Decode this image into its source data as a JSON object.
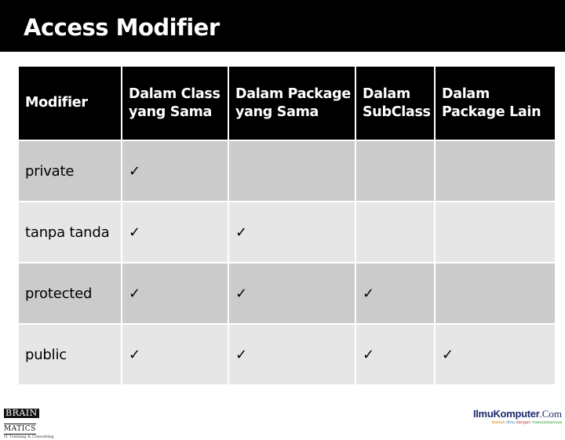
{
  "slide": {
    "title": "Access Modifier"
  },
  "table": {
    "headers": [
      "Modifier",
      "Dalam Class yang Sama",
      "Dalam Package yang Sama",
      "Dalam SubClass",
      "Dalam Package Lain"
    ],
    "check_symbol": "✓",
    "rows": [
      {
        "modifier": "private",
        "cells": [
          "✓",
          "",
          "",
          ""
        ]
      },
      {
        "modifier": "tanpa tanda",
        "cells": [
          "✓",
          "✓",
          "",
          ""
        ]
      },
      {
        "modifier": "protected",
        "cells": [
          "✓",
          "✓",
          "✓",
          ""
        ]
      },
      {
        "modifier": "public",
        "cells": [
          "✓",
          "✓",
          "✓",
          "✓"
        ]
      }
    ]
  },
  "footer": {
    "left_logo": {
      "word_boxed": "BRAIN",
      "word_rest": "MATICS",
      "tagline": "IT Training & Consulting"
    },
    "right_logo": {
      "name": "IlmuKomputer",
      "domain": ".Com",
      "tagline": [
        "Ikatlah",
        "ilmu",
        "dengan",
        "menuliskannya"
      ]
    }
  },
  "colors": {
    "title_bar": "#000000",
    "header_bg": "#000000",
    "row_odd": "#cbcbcb",
    "row_even": "#e6e6e6",
    "ilmu_brand": "#1e2a6e"
  }
}
